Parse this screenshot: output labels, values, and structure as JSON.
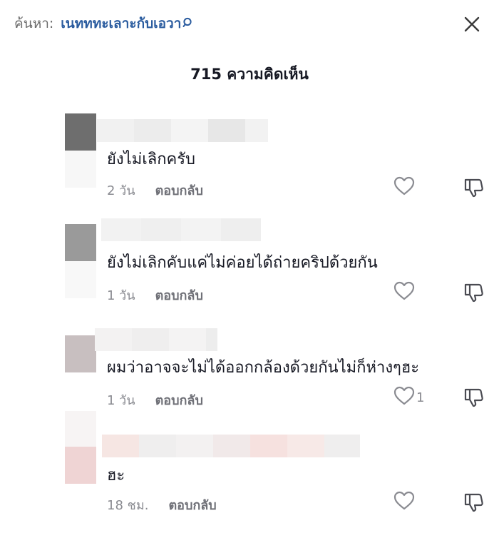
{
  "header": {
    "search_prefix": "ค้นหา:",
    "search_query": "เนทททะเลาะกับเอวา",
    "comment_count": "715 ความคิดเห็น"
  },
  "icons": {
    "search": "search-icon",
    "close": "close-icon",
    "like": "heart-outline-icon",
    "dislike": "thumbs-down-icon"
  },
  "colors": {
    "query_link": "#2b5c9f",
    "meta_text": "#8a8b91"
  },
  "comments": [
    {
      "text": "ยังไม่เลิกครับ",
      "time": "2 วัน",
      "reply": "ตอบกลับ",
      "likes": ""
    },
    {
      "text": "ยังไม่เลิกคับแค่ไม่ค่อยได้ถ่ายคริปด้วยกัน",
      "time": "1 วัน",
      "reply": "ตอบกลับ",
      "likes": ""
    },
    {
      "text": "ผมว่าอาจจะไม่ได้ออกกล้องด้วยกันไม่ก็ห่างๆฮะ",
      "time": "1 วัน",
      "reply": "ตอบกลับ",
      "likes": "1"
    },
    {
      "text": "ฮะ",
      "time": "18 ชม.",
      "reply": "ตอบกลับ",
      "likes": ""
    }
  ]
}
